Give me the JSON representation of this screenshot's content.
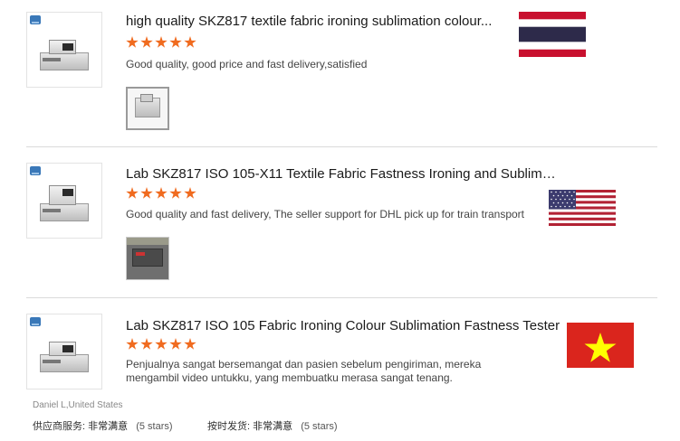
{
  "reviews": [
    {
      "title": "high quality SKZ817 textile fabric ironing sublimation colour...",
      "rating": 5,
      "comment": "Good quality, good price and fast delivery,satisfied",
      "country_flag": "thailand-flag-icon",
      "has_photo": true
    },
    {
      "title": "Lab SKZ817 ISO 105-X11 Textile Fabric Fastness Ironing and Sublimation ...",
      "rating": 5,
      "comment": "Good quality and fast delivery, The seller support for DHL pick up for train transport",
      "country_flag": "usa-flag-icon",
      "has_photo": true
    },
    {
      "title": "Lab SKZ817 ISO 105 Fabric Ironing Colour Sublimation Fastness Tester",
      "rating": 5,
      "comment": "Penjualnya sangat bersemangat dan pasien sebelum pengiriman, mereka mengambil video untukku, yang membuatku merasa sangat tenang.",
      "country_flag": "vietnam-flag-icon",
      "has_photo": false
    }
  ],
  "reviewer": "Daniel L,United States",
  "supplier_service": {
    "label": "供应商服务:",
    "value": "非常满意",
    "count": "(5 stars)"
  },
  "on_time_shipping": {
    "label": "按时发货:",
    "value": "非常满意",
    "count": "(5 stars)"
  },
  "colors": {
    "star": "#f06b1f",
    "divider": "#dadada"
  }
}
